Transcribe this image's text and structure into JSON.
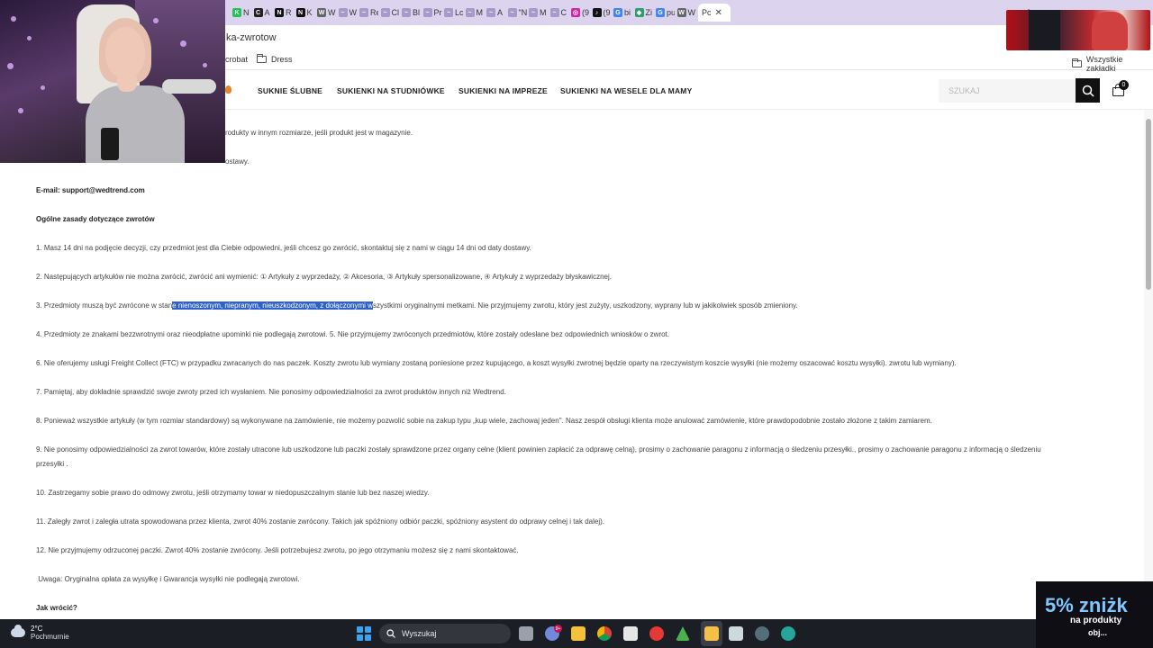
{
  "browser": {
    "tabs": [
      {
        "label": "N",
        "fav": "#24c15a",
        "icon": "K"
      },
      {
        "label": "A",
        "fav": "#222222",
        "icon": "C"
      },
      {
        "label": "R",
        "fav": "#111111",
        "icon": "N"
      },
      {
        "label": "K",
        "fav": "#111111",
        "icon": "N"
      },
      {
        "label": "W",
        "fav": "#666666",
        "icon": "W"
      },
      {
        "label": "W",
        "fav": "#a59ac8",
        "icon": "~"
      },
      {
        "label": "Re",
        "fav": "#a59ac8",
        "icon": "~"
      },
      {
        "label": "Cl",
        "fav": "#a59ac8",
        "icon": "~"
      },
      {
        "label": "Bl",
        "fav": "#a59ac8",
        "icon": "~"
      },
      {
        "label": "Pr",
        "fav": "#a59ac8",
        "icon": "~"
      },
      {
        "label": "Lc",
        "fav": "#a59ac8",
        "icon": "~"
      },
      {
        "label": "M",
        "fav": "#a59ac8",
        "icon": "~"
      },
      {
        "label": "A",
        "fav": "#a59ac8",
        "icon": "~"
      },
      {
        "label": "\"N",
        "fav": "#a59ac8",
        "icon": "~"
      },
      {
        "label": "M",
        "fav": "#a59ac8",
        "icon": "~"
      },
      {
        "label": "C",
        "fav": "#a59ac8",
        "icon": "~"
      },
      {
        "label": "(9",
        "fav": "#d6249f",
        "icon": "◎"
      },
      {
        "label": "(9",
        "fav": "#111111",
        "icon": "♪"
      },
      {
        "label": "bi",
        "fav": "#4285f4",
        "icon": "G"
      },
      {
        "label": "Zi",
        "fav": "#2c9f6b",
        "icon": "◆"
      },
      {
        "label": "pu",
        "fav": "#4285f4",
        "icon": "G"
      },
      {
        "label": "W",
        "fav": "#666666",
        "icon": "W"
      }
    ],
    "active_tab_label": "Pc",
    "active_tab_close": "✕",
    "new_tab": "+",
    "url": "ka-zwrotow",
    "bookmarks": [
      {
        "label": "crobat",
        "folder": false
      },
      {
        "label": "Dress",
        "folder": true
      }
    ],
    "all_bookmarks": "Wszystkie zakładki"
  },
  "site": {
    "nav": [
      "SUKNIE ŚLUBNE",
      "SUKIENKI NA STUDNIÓWKE",
      "SUKIENKI NA IMPREZE",
      "SUKIENKI NA WESELE DLA MAMY"
    ],
    "search_placeholder": "SZUKAJ",
    "cart_count": "0"
  },
  "article": {
    "line_0": "rodukty w innym rozmiarze, jeśli produkt jest w magazynie.",
    "line_1": "ostawy.",
    "email_label": "E-mail:",
    "email_value": "support@wedtrend.com",
    "heading": "Ogólne zasady dotyczące zwrotów",
    "p1": "1. Masz 14 dni na podjęcie decyzji, czy przedmiot jest dla Ciebie odpowiedni, jeśli chcesz go zwrócić, skontaktuj się z nami w ciągu 14 dni od daty dostawy.",
    "p2": "2. Następujących artykułów nie można zwrócić, zwrócić ani wymienić: ① Artykuły z wyprzedaży, ② Akcesoria, ③ Artykuły spersonalizowane, ④ Artykuły z wyprzedaży błyskawicznej.",
    "p3_a": "3. Przedmioty muszą być zwrócone w stan",
    "p3_hl": "e nienoszonym, niepranym, nieuszkodzonym, z dołączonymi w",
    "p3_b": "szystkimi oryginalnymi metkami. Nie przyjmujemy zwrotu, który jest zużyty, uszkodzony, wyprany lub w jakikolwiek sposób zmieniony.",
    "p4": "4. Przedmioty ze znakami bezzwrotnymi oraz nieodpłatne upominki nie podlegają zwrotowi. 5. Nie przyjmujemy zwróconych przedmiotów, które zostały odesłane bez odpowiednich wniosków o zwrot.",
    "p6": "6. Nie oferujemy usługi Freight Collect (FTC) w przypadku zwracanych do nas paczek. Koszty zwrotu lub wymiany zostaną poniesione przez kupującego, a koszt wysyłki zwrotnej będzie oparty na rzeczywistym koszcie wysyłki (nie możemy oszacować kosztu wysyłki). zwrotu lub wymiany).",
    "p7": "7. Pamiętaj, aby dokładnie sprawdzić swoje zwroty przed ich wysłaniem. Nie ponosimy odpowiedzialności za zwrot produktów innych niż Wedtrend.",
    "p8": "8. Ponieważ wszystkie artykuły (w tym rozmiar standardowy) są wykonywane na zamówienie, nie możemy pozwolić sobie na zakup typu „kup wiele, zachowaj jeden\". Nasz zespół obsługi klienta może anulować zamówienie, które prawdopodobnie zostało złożone z takim zamiarem.",
    "p9_a": "9. Nie ponosimy odpowiedzialności za zwrot towarów, które zostały utracone lub uszkodzone lub paczki zostały sprawdzone przez organy celne (klient powinien zapłacić za odprawę celną), prosimy o zachowanie paragonu z informacją o śledzeniu przesyłki., prosimy o zachowanie paragonu z informacją o śledzeniu",
    "p9_b": "przesyłki .",
    "p10": "10. Zastrzegamy sobie prawo do odmowy zwrotu, jeśli otrzymamy towar w niedopuszczalnym stanie lub bez naszej wiedzy.",
    "p11": "11. Zaległy zwrot i zaległa utrata spowodowana przez klienta, zwrot 40% zostanie zwrócony. Takich jak spóźniony odbiór paczki, spóźniony asystent do odprawy celnej i tak dalej).",
    "p12": "12. Nie przyjmujemy odrzuconej paczki. Zwrot 40% zostanie zwrócony. Jeśli potrzebujesz zwrotu, po jego otrzymaniu możesz się z nami skontaktować.",
    "note": " Uwaga: Oryginalna opłata za wysyłkę i Gwarancja wysyłki nie podlegają zwrotowi.",
    "how_heading": "Jak wrócić?"
  },
  "promo": {
    "percent": "5% zniżk",
    "line1": "na produkty",
    "line2": "obj..."
  },
  "taskbar": {
    "temp": "2°C",
    "weather": "Pochmurnie",
    "search": "Wyszukaj",
    "badge": "9+"
  }
}
